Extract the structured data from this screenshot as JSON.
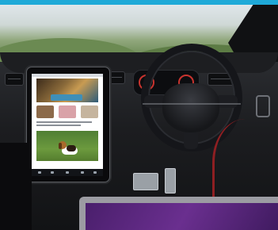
{
  "scene": {
    "description_tag": "tesla-interior-photo",
    "tablet": {
      "hero_caption": "",
      "thumbnail_colors": [
        "#8c6a4a",
        "#d9a2a8",
        "#c5b49e"
      ]
    },
    "colors": {
      "accent_bar": "#1fa9d8",
      "laptop_screen": "#5a2a80",
      "seat_trim": "#8f1f22"
    }
  }
}
